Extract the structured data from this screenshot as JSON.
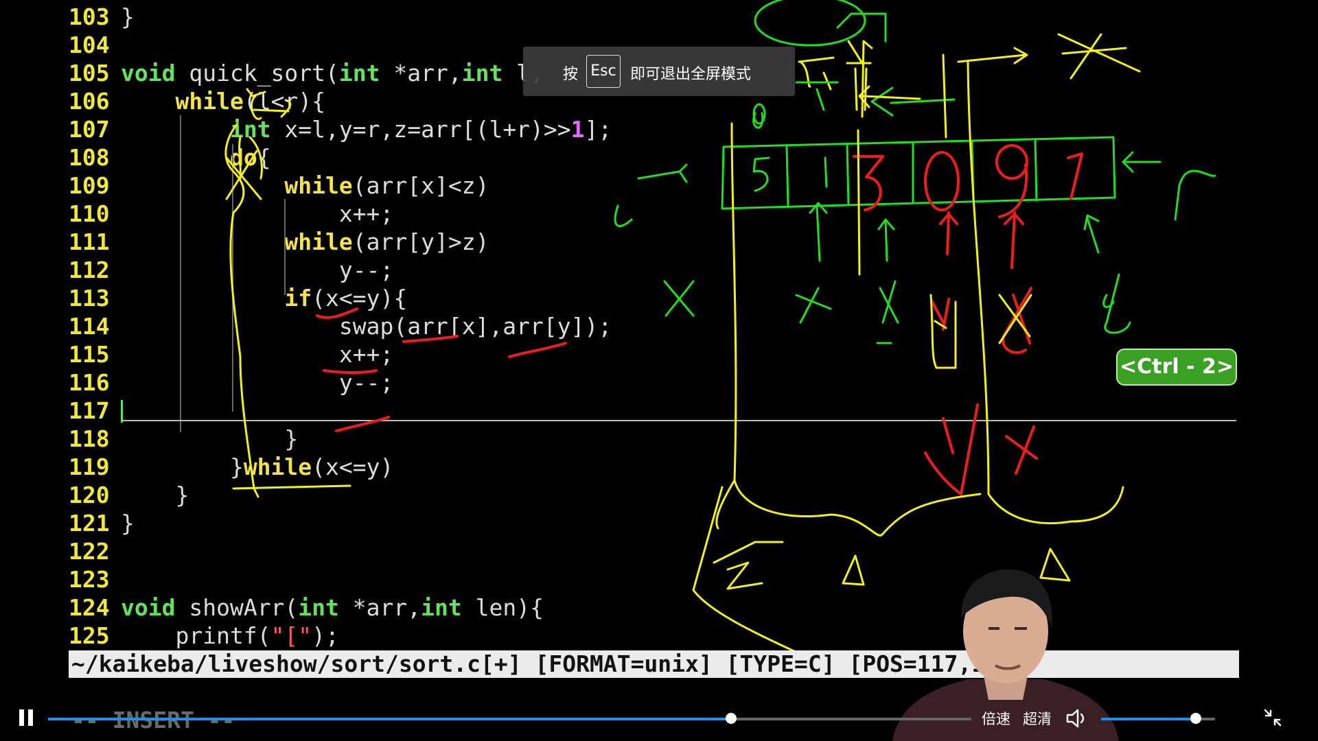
{
  "editor": {
    "lines": [
      {
        "n": "103",
        "segs": [
          {
            "t": "}",
            "c": ""
          }
        ]
      },
      {
        "n": "104",
        "segs": []
      },
      {
        "n": "105",
        "segs": [
          {
            "t": "void",
            "c": "kw"
          },
          {
            "t": " quick_sort(",
            "c": ""
          },
          {
            "t": "int",
            "c": "kw"
          },
          {
            "t": " *arr,",
            "c": ""
          },
          {
            "t": "int",
            "c": "kw"
          },
          {
            "t": " l,",
            "c": ""
          }
        ]
      },
      {
        "n": "106",
        "segs": [
          {
            "t": "    ",
            "c": ""
          },
          {
            "t": "while",
            "c": "kw2"
          },
          {
            "t": "(l<r){",
            "c": ""
          }
        ]
      },
      {
        "n": "107",
        "segs": [
          {
            "t": "        ",
            "c": ""
          },
          {
            "t": "int",
            "c": "kw"
          },
          {
            "t": " x=l,y=r,z=arr[(l+r)>>",
            "c": ""
          },
          {
            "t": "1",
            "c": "num"
          },
          {
            "t": "];",
            "c": ""
          }
        ]
      },
      {
        "n": "108",
        "segs": [
          {
            "t": "        ",
            "c": ""
          },
          {
            "t": "do",
            "c": "kw2"
          },
          {
            "t": "{",
            "c": ""
          }
        ]
      },
      {
        "n": "109",
        "segs": [
          {
            "t": "            ",
            "c": ""
          },
          {
            "t": "while",
            "c": "kw2"
          },
          {
            "t": "(arr[x]<z)",
            "c": ""
          }
        ]
      },
      {
        "n": "110",
        "segs": [
          {
            "t": "                x++;",
            "c": ""
          }
        ]
      },
      {
        "n": "111",
        "segs": [
          {
            "t": "            ",
            "c": ""
          },
          {
            "t": "while",
            "c": "kw2"
          },
          {
            "t": "(arr[y]>z)",
            "c": ""
          }
        ]
      },
      {
        "n": "112",
        "segs": [
          {
            "t": "                y--;",
            "c": ""
          }
        ]
      },
      {
        "n": "113",
        "segs": [
          {
            "t": "            ",
            "c": ""
          },
          {
            "t": "if",
            "c": "kw2"
          },
          {
            "t": "(x<=y){",
            "c": ""
          }
        ]
      },
      {
        "n": "114",
        "segs": [
          {
            "t": "                swap(arr[x],arr[y]);",
            "c": ""
          }
        ]
      },
      {
        "n": "115",
        "segs": [
          {
            "t": "                x++;",
            "c": ""
          }
        ]
      },
      {
        "n": "116",
        "segs": [
          {
            "t": "                y--;",
            "c": ""
          }
        ]
      },
      {
        "n": "117",
        "segs": []
      },
      {
        "n": "118",
        "segs": [
          {
            "t": "            }",
            "c": ""
          }
        ]
      },
      {
        "n": "119",
        "segs": [
          {
            "t": "        }",
            "c": ""
          },
          {
            "t": "while",
            "c": "kw2"
          },
          {
            "t": "(x<=y)",
            "c": ""
          }
        ]
      },
      {
        "n": "120",
        "segs": [
          {
            "t": "    }",
            "c": ""
          }
        ]
      },
      {
        "n": "121",
        "segs": [
          {
            "t": "}",
            "c": ""
          }
        ]
      },
      {
        "n": "122",
        "segs": []
      },
      {
        "n": "123",
        "segs": []
      },
      {
        "n": "124",
        "segs": [
          {
            "t": "void",
            "c": "kw"
          },
          {
            "t": " showArr(",
            "c": ""
          },
          {
            "t": "int",
            "c": "kw"
          },
          {
            "t": " *arr,",
            "c": ""
          },
          {
            "t": "int",
            "c": "kw"
          },
          {
            "t": " len){",
            "c": ""
          }
        ]
      },
      {
        "n": "125",
        "segs": [
          {
            "t": "    printf(",
            "c": ""
          },
          {
            "t": "\"[\"",
            "c": "str"
          },
          {
            "t": ");",
            "c": ""
          }
        ]
      }
    ],
    "status_line": "~/kaikeba/liveshow/sort/sort.c[+] [FORMAT=unix] [TYPE=C] [POS=117,1][",
    "mode": "-- INSERT --"
  },
  "toast": {
    "before": "按",
    "key": "Esc",
    "after": "即可退出全屏模式"
  },
  "badge": {
    "label": "<Ctrl - 2>"
  },
  "annotations": {
    "green_labels": [
      "0",
      "z",
      "r",
      "x",
      "x",
      "y"
    ],
    "red_digits": [
      "3",
      "0",
      "9",
      "7"
    ],
    "array_digits": [
      "5",
      "1"
    ]
  },
  "player": {
    "progress": 0.74,
    "speed_label": "倍速",
    "quality_label": "超清",
    "volume": 0.83
  },
  "colors": {
    "green": "#22dd22",
    "yellow": "#f4f01a",
    "red": "#ee1c1c",
    "accent": "#1f8ff0"
  }
}
